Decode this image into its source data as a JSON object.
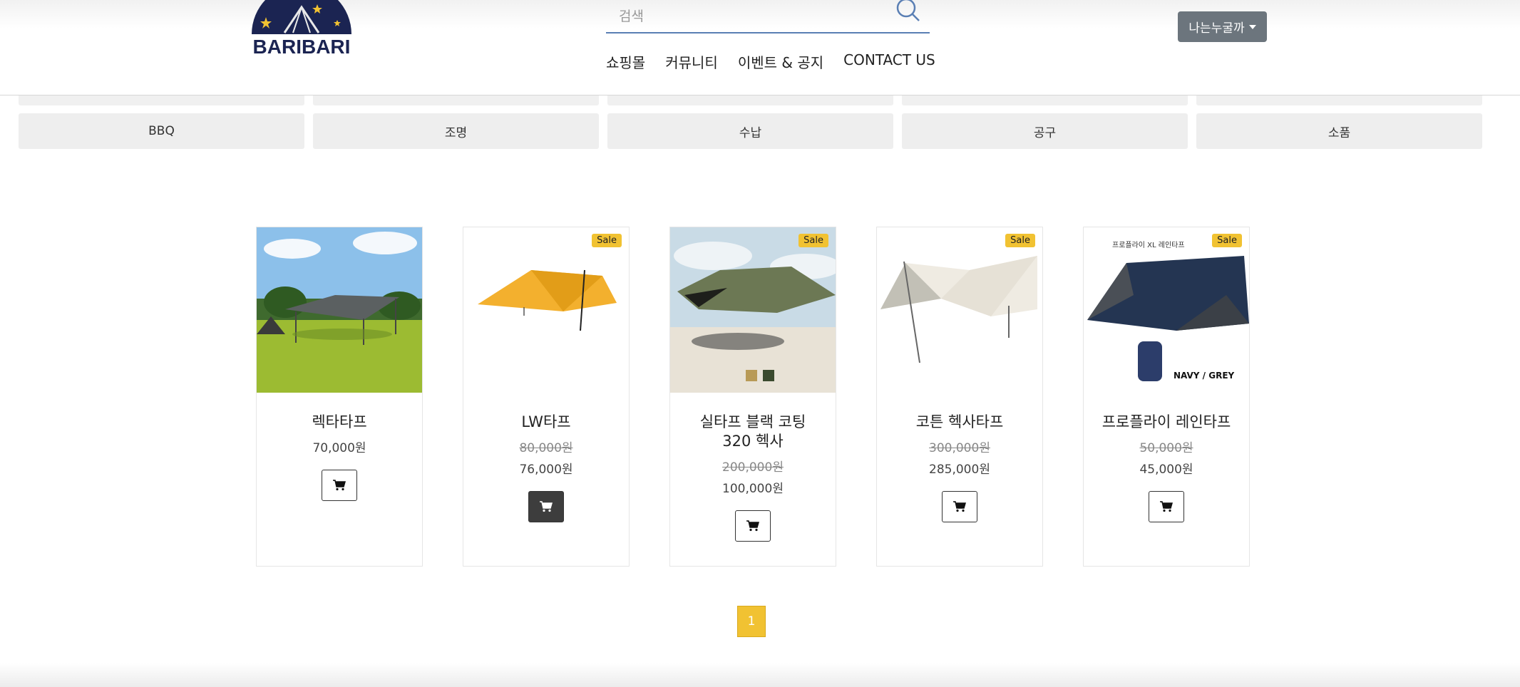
{
  "header": {
    "logo_text": "BARIBARI",
    "search_placeholder": "검색",
    "nav": [
      "쇼핑몰",
      "커뮤니티",
      "이벤트 & 공지",
      "CONTACT US"
    ],
    "user_menu_label": "나는누굴까"
  },
  "categories": [
    "BBQ",
    "조명",
    "수납",
    "공구",
    "소품"
  ],
  "products": [
    {
      "name": "렉타타프",
      "price": "70,000원",
      "sale": false
    },
    {
      "name": "LW타프",
      "original_price": "80,000원",
      "price": "76,000원",
      "sale": true,
      "sale_label": "Sale"
    },
    {
      "name": "실타프 블랙 코팅 320 헥사",
      "original_price": "200,000원",
      "price": "100,000원",
      "sale": true,
      "sale_label": "Sale"
    },
    {
      "name": "코튼 헥사타프",
      "original_price": "300,000원",
      "price": "285,000원",
      "sale": true,
      "sale_label": "Sale"
    },
    {
      "name": "프로플라이 레인타프",
      "original_price": "50,000원",
      "price": "45,000원",
      "sale": true,
      "sale_label": "Sale",
      "image_text": {
        "top": "프로플라이 XL 레인타프",
        "bottom": "NAVY / GREY"
      }
    }
  ],
  "pagination": {
    "current": "1"
  },
  "colors": {
    "accent": "#f1c232",
    "brand_navy": "#1b2452",
    "user_button": "#6c757d"
  }
}
